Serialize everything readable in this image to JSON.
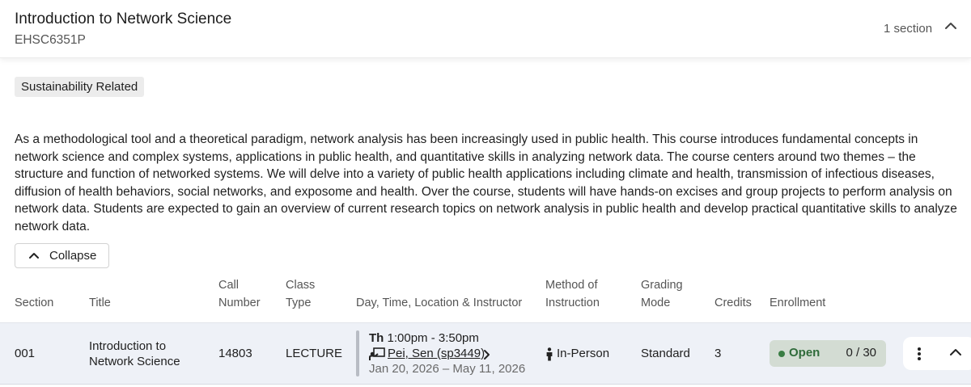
{
  "course": {
    "title": "Introduction to Network Science",
    "code": "EHSC6351P",
    "section_count": "1 section"
  },
  "tag": "Sustainability Related",
  "description": "As a methodological tool and a theoretical paradigm, network analysis has been increasingly used in public health. This course introduces fundamental concepts in network science and complex systems, applications in public health, and quantitative skills in analyzing network data. The course centers around two themes – the structure and function of networked systems. We will delve into a variety of public health applications including climate and health, transmission of infectious diseases, diffusion of health behaviors, social networks, and exposome and health. Over the course, students will have hands-on excises and group projects to perform analysis on network data. Students are expected to gain an overview of current research topics on network analysis in public health and develop practical quantitative skills to analyze network data.",
  "collapse_label": "Collapse",
  "table": {
    "headers": {
      "section": "Section",
      "title": "Title",
      "call_number_1": "Call",
      "call_number_2": "Number",
      "class_type_1": "Class",
      "class_type_2": "Type",
      "day_time": "Day, Time, Location & Instructor",
      "method_1": "Method of",
      "method_2": "Instruction",
      "grading_1": "Grading",
      "grading_2": "Mode",
      "credits": "Credits",
      "enrollment": "Enrollment"
    },
    "rows": [
      {
        "section": "001",
        "title_line1": "Introduction to",
        "title_line2": "Network Science",
        "call_number": "14803",
        "class_type": "LECTURE",
        "day": "Th",
        "time": "1:00pm - 3:50pm",
        "instructor": "Pei, Sen (sp3449)",
        "dates": "Jan 20, 2026 – May 11, 2026",
        "method": "In-Person",
        "grading": "Standard",
        "credits": "3",
        "enrollment_status": "Open",
        "enrollment_count": "0 / 30"
      }
    ]
  },
  "icons": {
    "header_chevron": "chevron-up-icon",
    "collapse_chevron": "chevron-up-icon",
    "instructor_icon": "teacher-board-icon",
    "instructor_arrow": "chevron-right-icon",
    "method_icon": "person-icon",
    "kebab": "more-vertical-icon",
    "row_chevron": "chevron-up-icon"
  },
  "colors": {
    "row_background": "#eef1f7",
    "open_pill": "#d3dcd3",
    "open_text": "#2f6b3a"
  }
}
